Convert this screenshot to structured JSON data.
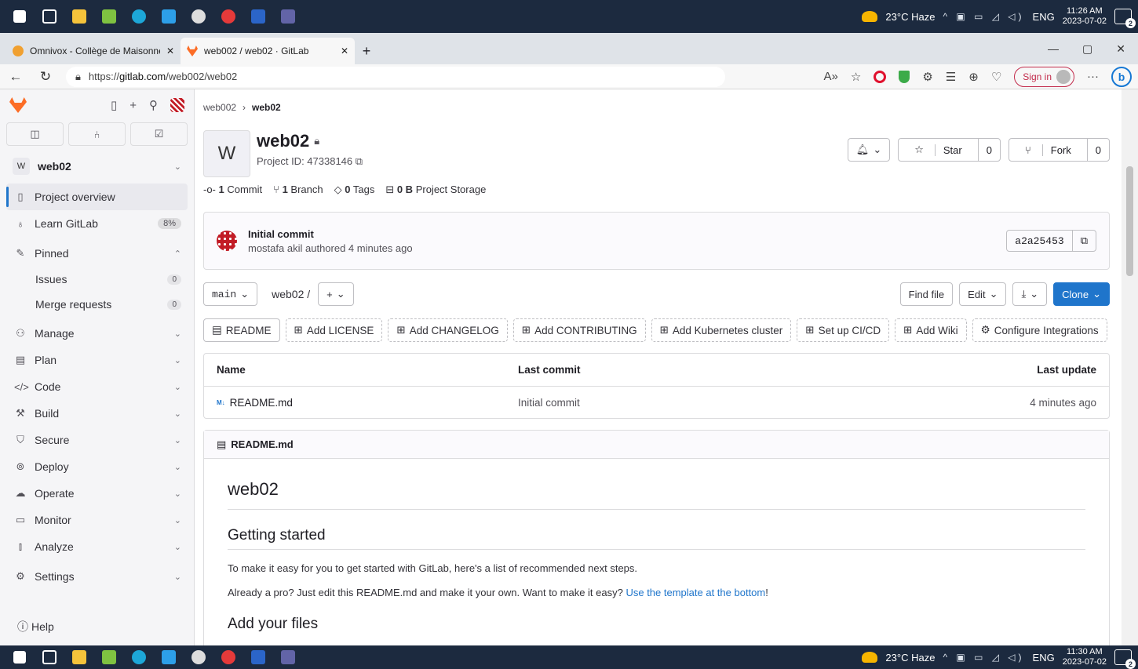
{
  "taskbar_top": {
    "weather": "23°C Haze",
    "lang": "ENG",
    "time": "11:26 AM",
    "date": "2023-07-02",
    "notifications": "2"
  },
  "taskbar_bottom": {
    "weather": "23°C Haze",
    "lang": "ENG",
    "time": "11:30 AM",
    "date": "2023-07-02",
    "notifications": "2"
  },
  "browser": {
    "tabs": [
      {
        "title": "Omnivox - Collège de Maisonneuve"
      },
      {
        "title": "web002 / web02 · GitLab"
      }
    ],
    "url_scheme": "https://",
    "url_host": "gitlab.com",
    "url_path": "/web002/web02",
    "signin_label": "Sign in"
  },
  "sidebar": {
    "project_initial": "W",
    "project_name": "web02",
    "items": {
      "overview": "Project overview",
      "learn": "Learn GitLab",
      "learn_pct": "8%",
      "pinned": "Pinned",
      "issues": "Issues",
      "issues_count": "0",
      "mrs": "Merge requests",
      "mrs_count": "0",
      "manage": "Manage",
      "plan": "Plan",
      "code": "Code",
      "build": "Build",
      "secure": "Secure",
      "deploy": "Deploy",
      "operate": "Operate",
      "monitor": "Monitor",
      "analyze": "Analyze",
      "settings": "Settings"
    },
    "help": "Help"
  },
  "main": {
    "breadcrumb": [
      "web002",
      "web02"
    ],
    "project_initial": "W",
    "project_title": "web02",
    "project_id": "Project ID: 47338146",
    "star_label": "Star",
    "star_count": "0",
    "fork_label": "Fork",
    "fork_count": "0",
    "stats": {
      "commits_n": "1",
      "commits_l": "Commit",
      "branches_n": "1",
      "branches_l": "Branch",
      "tags_n": "0",
      "tags_l": "Tags",
      "storage_n": "0 B",
      "storage_l": "Project Storage"
    },
    "commit": {
      "title": "Initial commit",
      "author": "mostafa akil",
      "meta": "authored 4 minutes ago",
      "sha": "a2a25453"
    },
    "branch": "main",
    "path": "web02 /",
    "find_file": "Find file",
    "edit": "Edit",
    "clone": "Clone",
    "shortcuts": [
      "README",
      "Add LICENSE",
      "Add CHANGELOG",
      "Add CONTRIBUTING",
      "Add Kubernetes cluster",
      "Set up CI/CD",
      "Add Wiki",
      "Configure Integrations"
    ],
    "files_header": {
      "name": "Name",
      "last_commit": "Last commit",
      "last_update": "Last update"
    },
    "files": [
      {
        "name": "README.md",
        "commit": "Initial commit",
        "updated": "4 minutes ago"
      }
    ],
    "readme": {
      "file": "README.md",
      "h1": "web02",
      "h2_start": "Getting started",
      "p1": "To make it easy for you to get started with GitLab, here's a list of recommended next steps.",
      "p2": "Already a pro? Just edit this README.md and make it your own. Want to make it easy? ",
      "p2_link": "Use the template at the bottom",
      "p2_end": "!",
      "h2_files": "Add your files"
    }
  }
}
